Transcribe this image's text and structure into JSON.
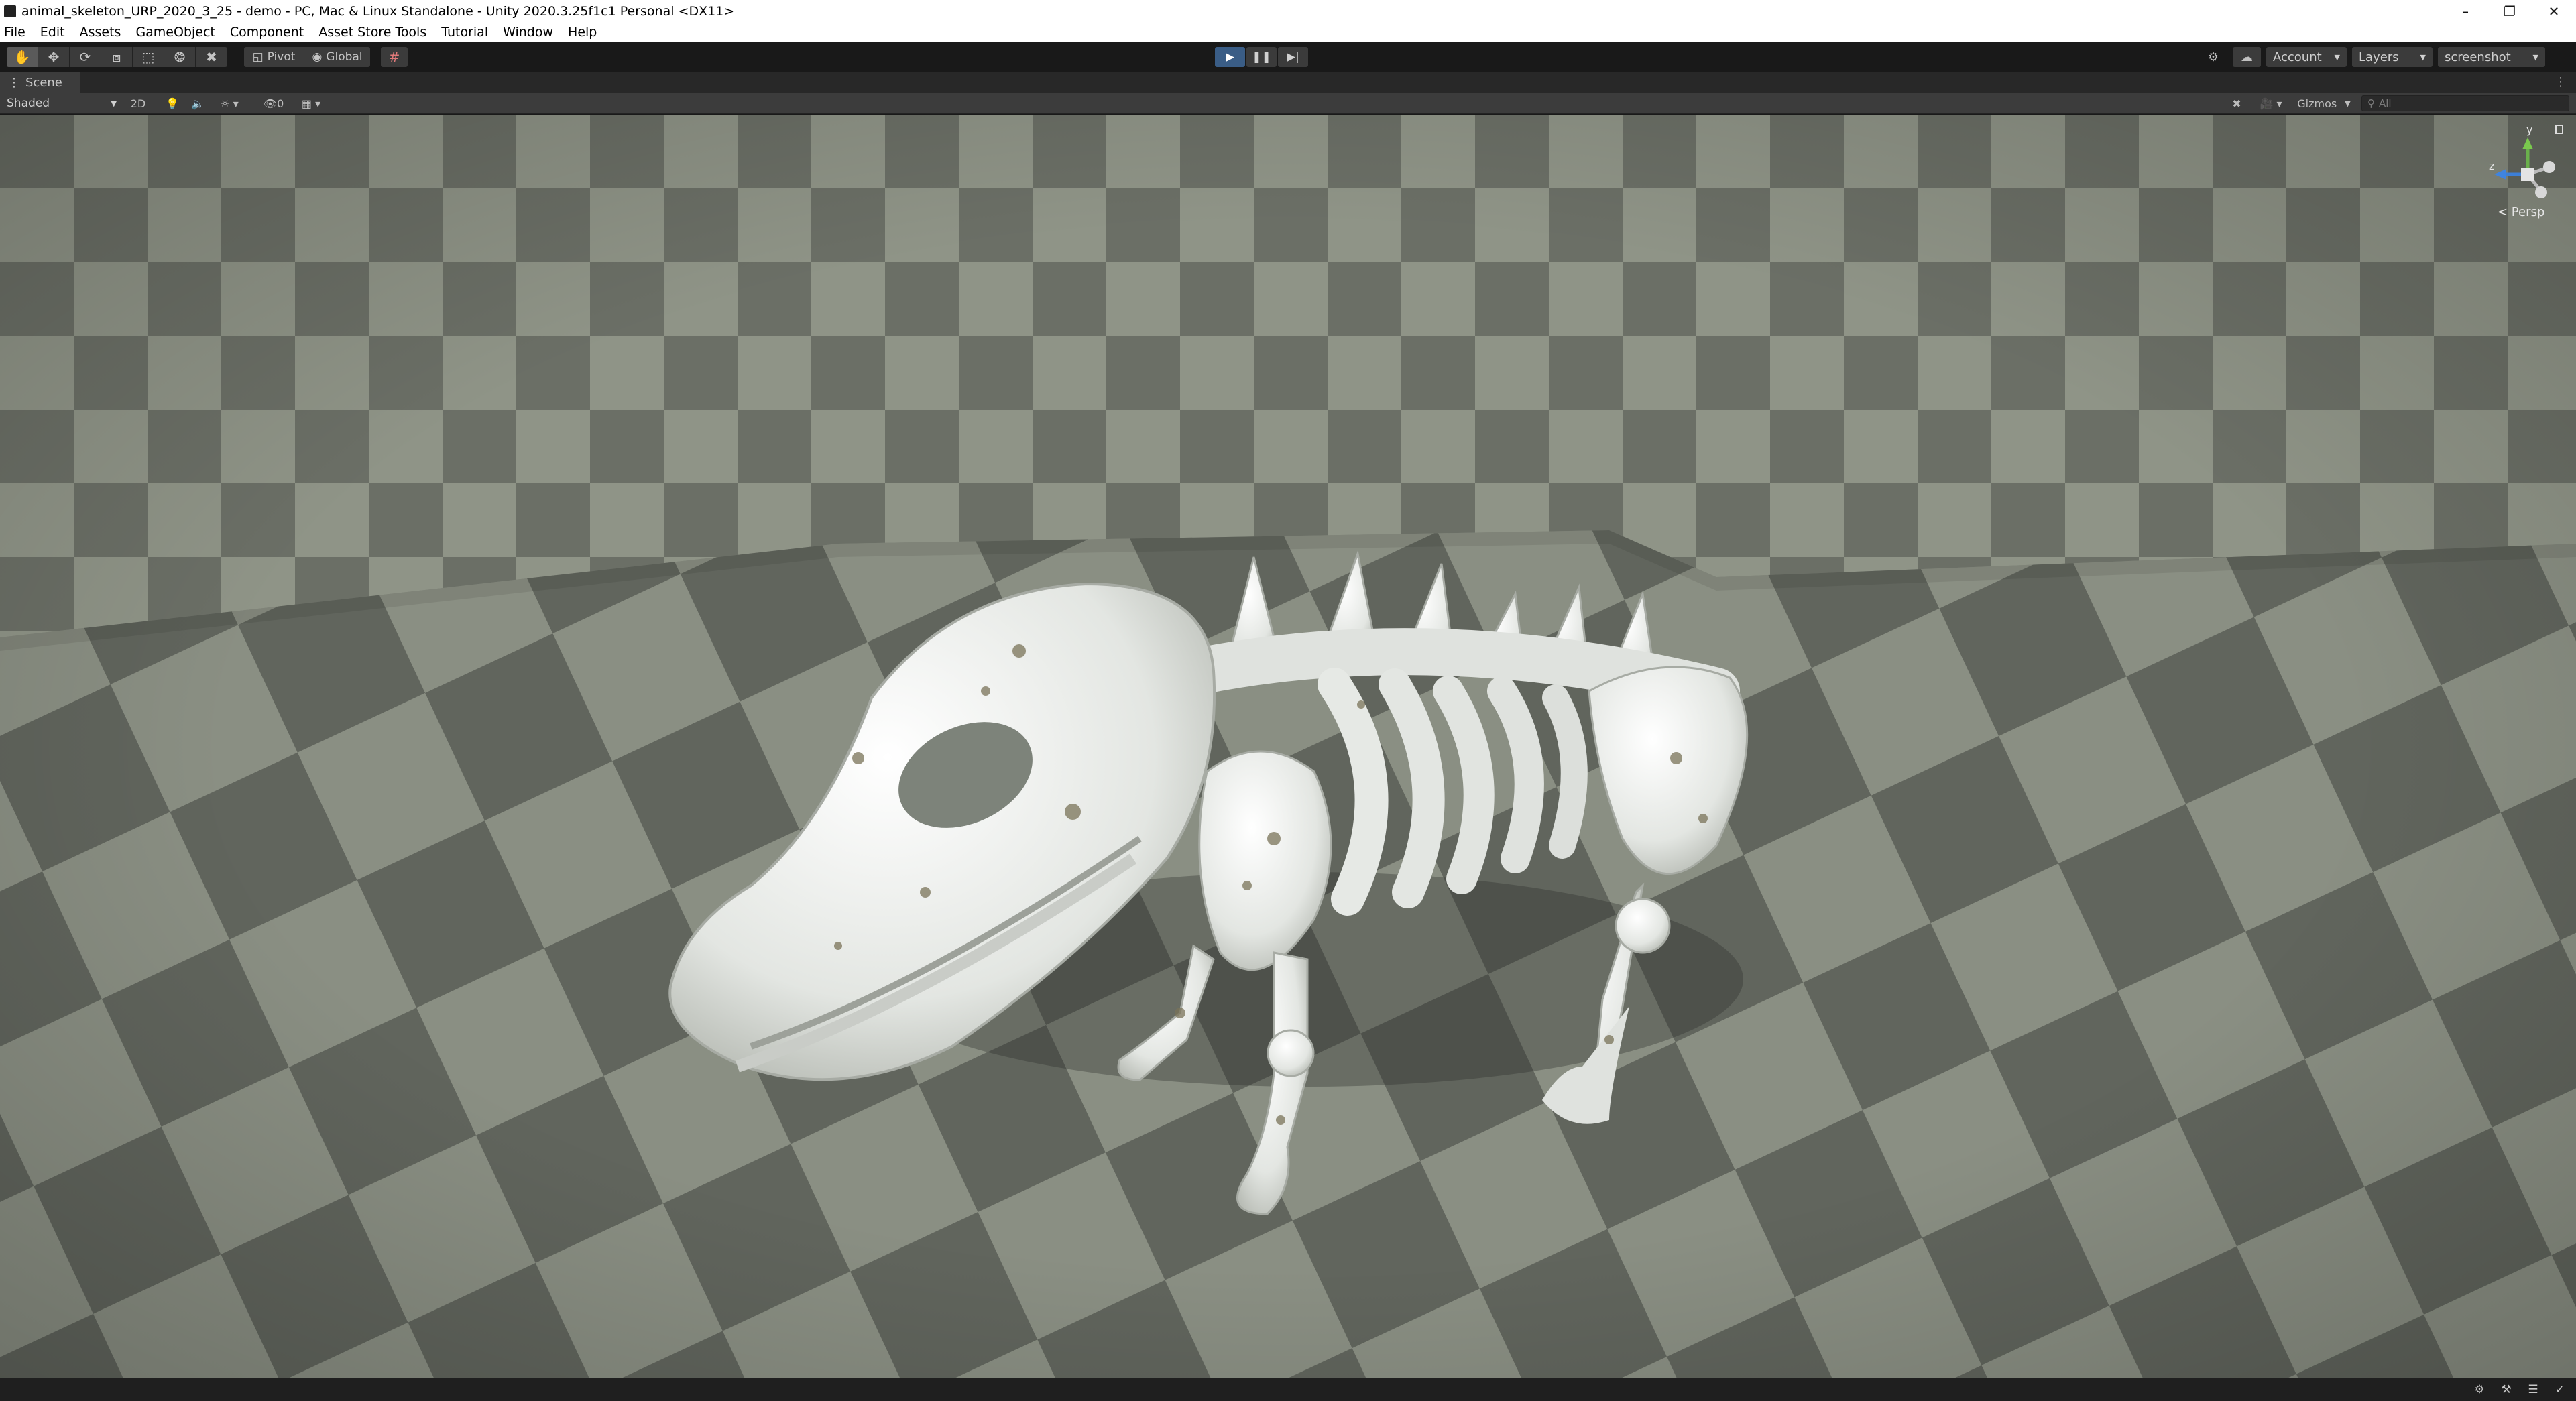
{
  "window": {
    "title": "animal_skeleton_URP_2020_3_25 - demo - PC, Mac & Linux Standalone - Unity 2020.3.25f1c1 Personal <DX11>"
  },
  "menu": [
    "File",
    "Edit",
    "Assets",
    "GameObject",
    "Component",
    "Asset Store Tools",
    "Tutorial",
    "Window",
    "Help"
  ],
  "toolbar": {
    "pivot_label": "Pivot",
    "global_label": "Global",
    "account_label": "Account",
    "layers_label": "Layers",
    "layout_label": "screenshot",
    "play_state": "playing"
  },
  "scene_tab": {
    "label": "Scene"
  },
  "scene_toolbar": {
    "shading_mode": "Shaded",
    "mode_2d": "2D",
    "hidden_count": "0",
    "gizmos_label": "Gizmos",
    "search_placeholder": "All"
  },
  "scene_gizmo": {
    "y_label": "y",
    "z_label": "z",
    "projection_label": "< Persp"
  },
  "colors": {
    "play_active": "#3a5d86",
    "checker_light": "#8f9487",
    "checker_dark": "#6b6f66",
    "bone": "#e9ebe8"
  }
}
